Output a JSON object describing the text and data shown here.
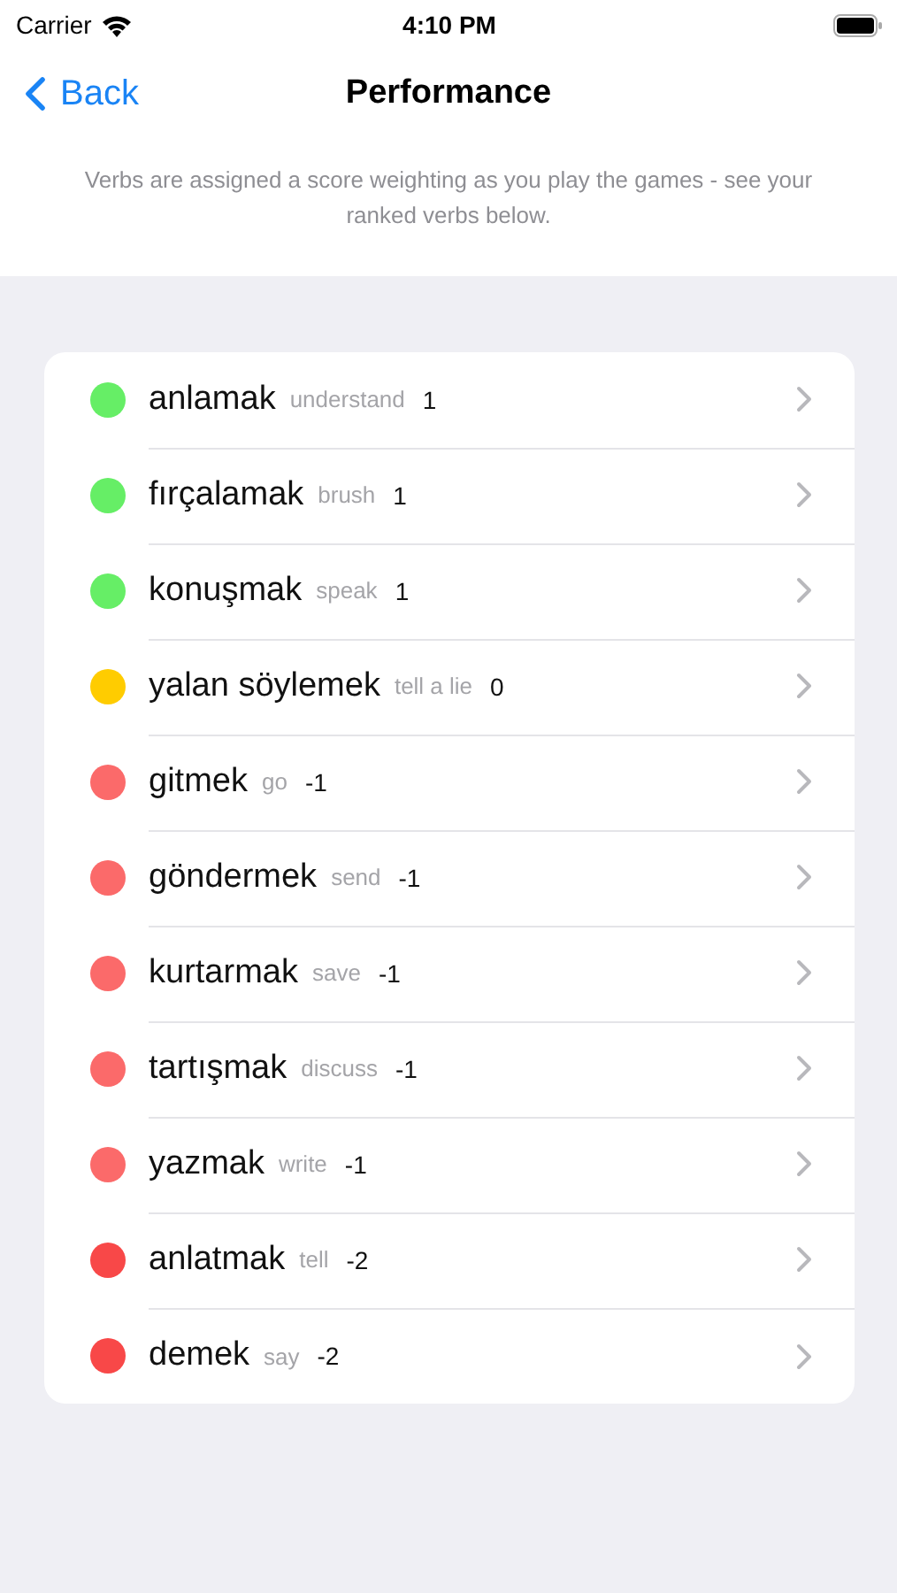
{
  "status_bar": {
    "carrier": "Carrier",
    "time": "4:10 PM"
  },
  "nav": {
    "back": "Back",
    "title": "Performance"
  },
  "description": "Verbs are assigned a score weighting as you play the games - see your ranked verbs below.",
  "verbs": [
    {
      "word": "anlamak",
      "meaning": "understand",
      "score": "1",
      "color": "#66ee66"
    },
    {
      "word": "fırçalamak",
      "meaning": "brush",
      "score": "1",
      "color": "#66ee66"
    },
    {
      "word": "konuşmak",
      "meaning": "speak",
      "score": "1",
      "color": "#66ee66"
    },
    {
      "word": "yalan söylemek",
      "meaning": "tell a lie",
      "score": "0",
      "color": "#ffcc00"
    },
    {
      "word": "gitmek",
      "meaning": "go",
      "score": "-1",
      "color": "#fb6a6a"
    },
    {
      "word": "göndermek",
      "meaning": "send",
      "score": "-1",
      "color": "#fb6a6a"
    },
    {
      "word": "kurtarmak",
      "meaning": "save",
      "score": "-1",
      "color": "#fb6a6a"
    },
    {
      "word": "tartışmak",
      "meaning": "discuss",
      "score": "-1",
      "color": "#fb6a6a"
    },
    {
      "word": "yazmak",
      "meaning": "write",
      "score": "-1",
      "color": "#fb6a6a"
    },
    {
      "word": "anlatmak",
      "meaning": "tell",
      "score": "-2",
      "color": "#f84848"
    },
    {
      "word": "demek",
      "meaning": "say",
      "score": "-2",
      "color": "#f84848"
    }
  ]
}
